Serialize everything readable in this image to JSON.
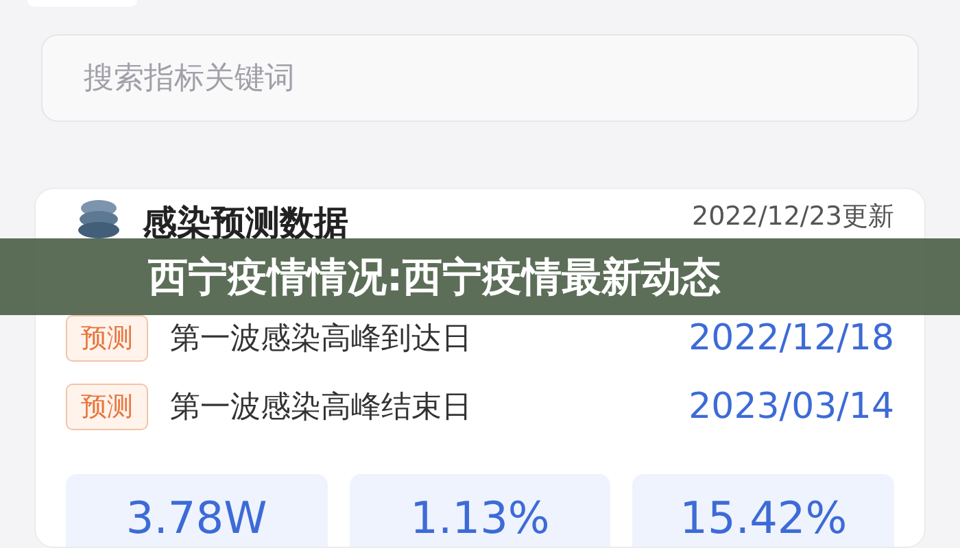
{
  "search": {
    "placeholder": "搜索指标关键词"
  },
  "card": {
    "title": "感染预测数据",
    "updated": "2022/12/23更新",
    "rows": [
      {
        "badge": "预测",
        "label": "第一波感染高峰到达日",
        "date": "2022/12/18"
      },
      {
        "badge": "预测",
        "label": "第一波感染高峰结束日",
        "date": "2023/03/14"
      }
    ],
    "stats": [
      "3.78W",
      "1.13%",
      "15.42%"
    ]
  },
  "banner": {
    "text": "西宁疫情情况:西宁疫情最新动态"
  }
}
